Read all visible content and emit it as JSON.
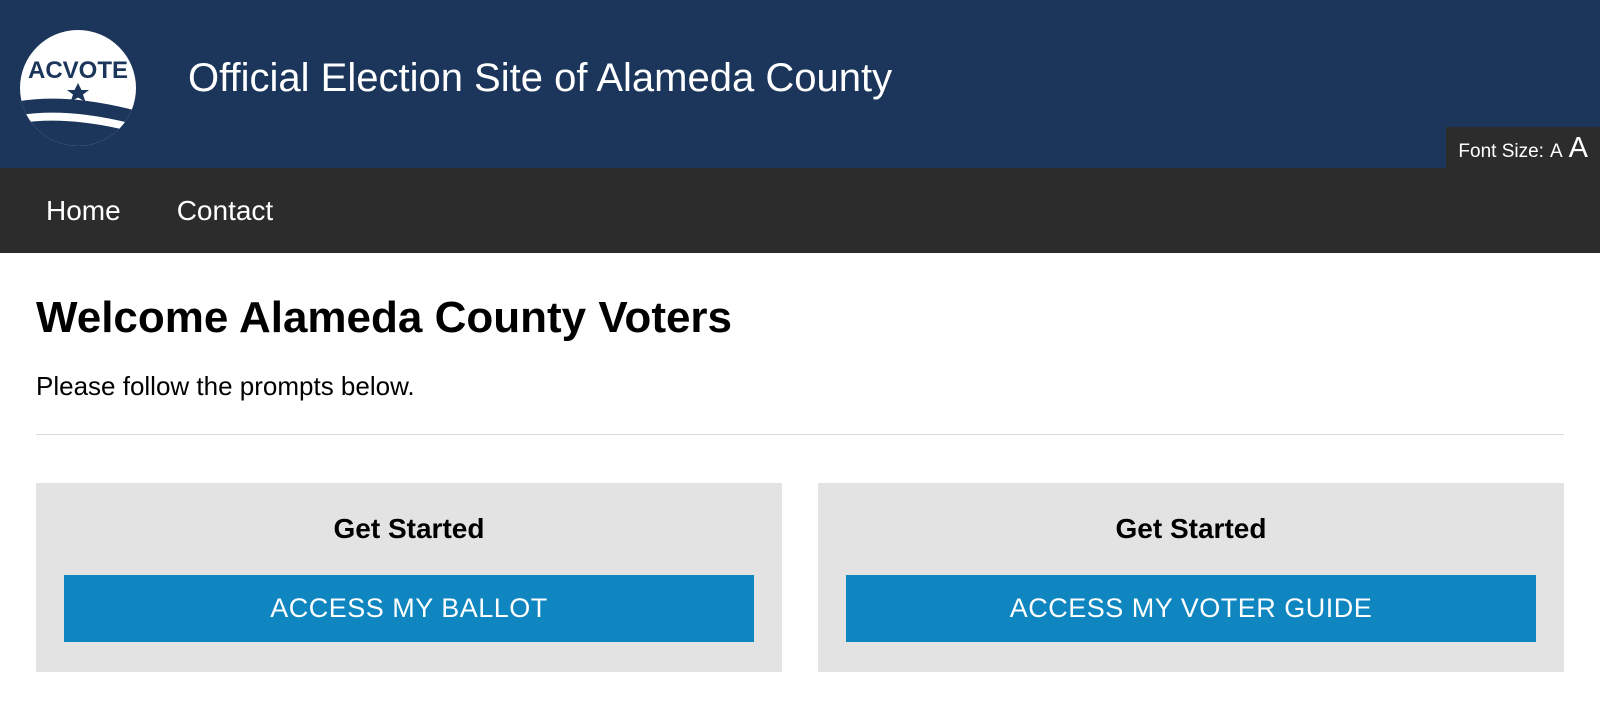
{
  "header": {
    "site_title": "Official Election Site of Alameda County",
    "logo_text": "ACVOTE",
    "font_size_label": "Font Size:",
    "font_size_small": "A",
    "font_size_large": "A"
  },
  "nav": {
    "items": [
      {
        "label": "Home"
      },
      {
        "label": "Contact"
      }
    ]
  },
  "main": {
    "title": "Welcome Alameda County Voters",
    "subtitle": "Please follow the prompts below.",
    "cards": [
      {
        "heading": "Get Started",
        "button": "ACCESS MY BALLOT"
      },
      {
        "heading": "Get Started",
        "button": "ACCESS MY VOTER GUIDE"
      }
    ]
  }
}
